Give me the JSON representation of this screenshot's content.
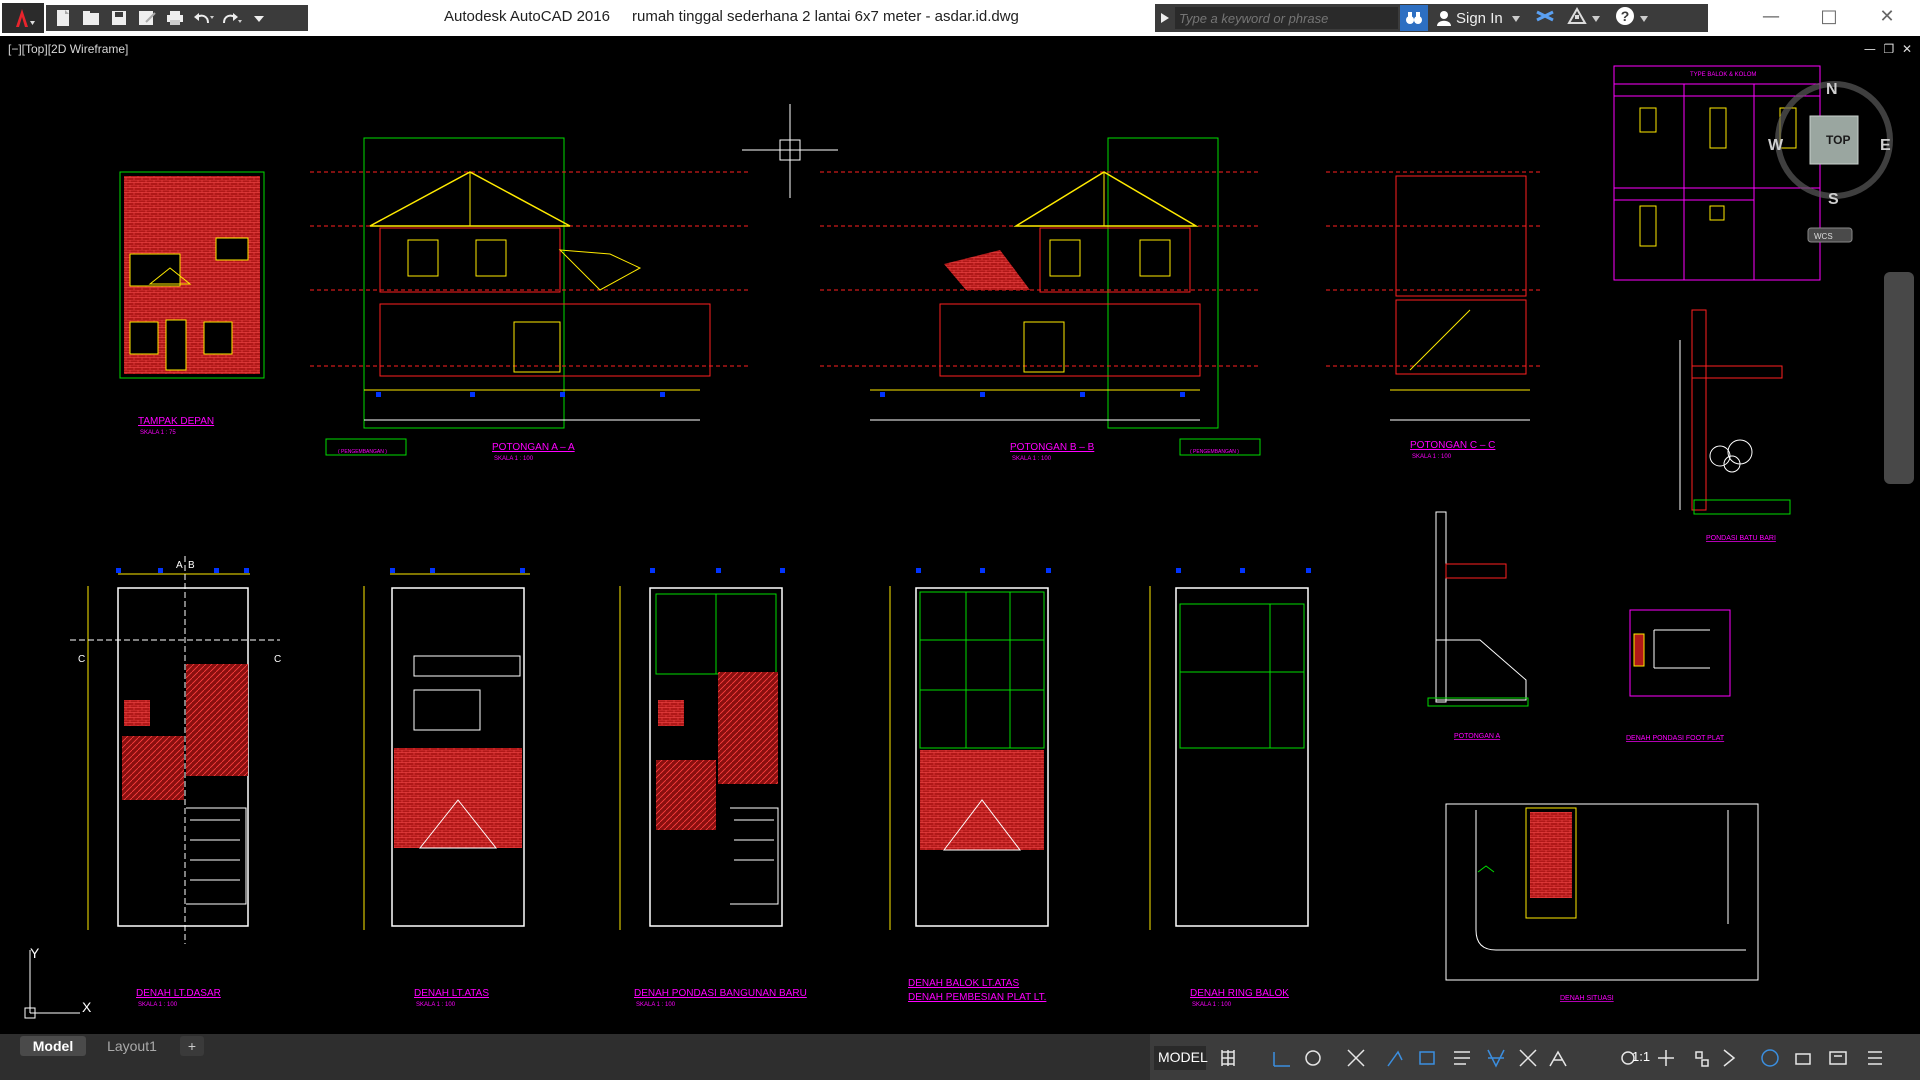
{
  "app": {
    "title": "Autodesk AutoCAD 2016",
    "filename": "rumah tinggal sederhana 2 lantai 6x7 meter - asdar.id.dwg"
  },
  "search": {
    "placeholder": "Type a keyword or phrase"
  },
  "account": {
    "sign_in": "Sign In"
  },
  "viewport": {
    "label": "[−][Top][2D Wireframe]",
    "ucs_x": "X",
    "ucs_y": "Y"
  },
  "viewcube": {
    "north": "N",
    "south": "S",
    "east": "E",
    "west": "W",
    "face": "TOP",
    "wcs": "WCS"
  },
  "drawing_titles": {
    "tampak_depan": "TAMPAK DEPAN",
    "potongan_aa": "POTONGAN A – A",
    "potongan_bb": "POTONGAN B – B",
    "potongan_cc": "POTONGAN C – C",
    "denah_dasar": "DENAH LT.DASAR",
    "denah_atas": "DENAH LT.ATAS",
    "denah_pondasi": "DENAH PONDASI BANGUNAN BARU",
    "denah_balok_1": "DENAH BALOK LT.ATAS",
    "denah_balok_2": "DENAH PEMBESIAN PLAT LT.",
    "denah_ring": "DENAH RING BALOK",
    "potongan_a": "POTONGAN A",
    "pondasi_batu": "PONDASI BATU BARI",
    "pondasi_foot": "DENAH PONDASI FOOT PLAT",
    "denah_situasi": "DENAH SITUASI",
    "type_balok": "TYPE BALOK & KOLOM",
    "bangunan_baru_1": "BANGUNAN BARU",
    "bangunan_baru_2": "( PENGEMBANGAN )",
    "skala_75": "SKALA 1 : 75",
    "skala_100": "SKALA 1 : 100"
  },
  "tabs": {
    "model": "Model",
    "layout1": "Layout1",
    "add": "+"
  },
  "status": {
    "model": "MODEL",
    "scale": "1:1"
  }
}
